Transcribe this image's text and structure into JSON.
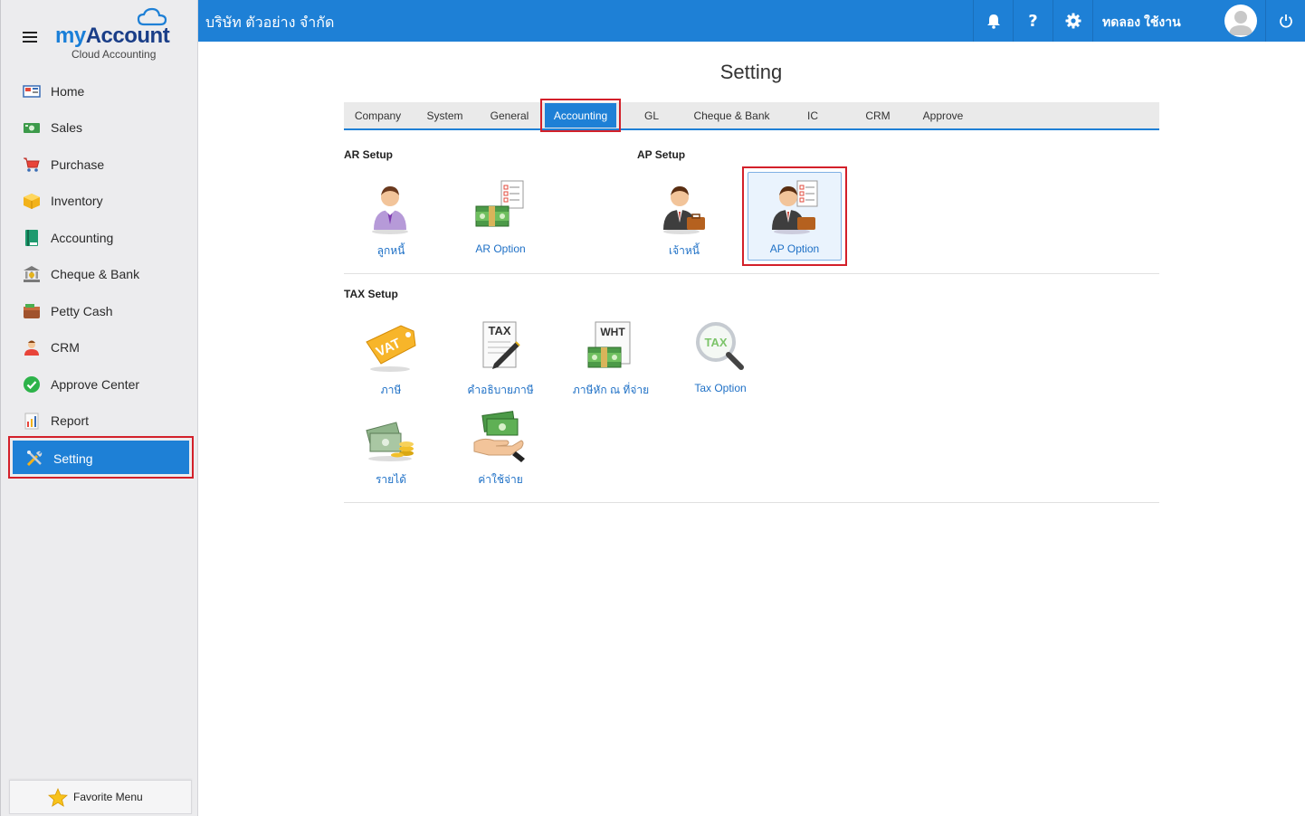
{
  "app": {
    "logo_main": "myAccount",
    "logo_sub": "Cloud Accounting"
  },
  "sidebar": {
    "items": [
      {
        "label": "Home",
        "icon": "home-icon"
      },
      {
        "label": "Sales",
        "icon": "sales-icon"
      },
      {
        "label": "Purchase",
        "icon": "cart-icon"
      },
      {
        "label": "Inventory",
        "icon": "box-icon"
      },
      {
        "label": "Accounting",
        "icon": "book-icon"
      },
      {
        "label": "Cheque & Bank",
        "icon": "bank-icon"
      },
      {
        "label": "Petty Cash",
        "icon": "wallet-icon"
      },
      {
        "label": "CRM",
        "icon": "people-icon"
      },
      {
        "label": "Approve Center",
        "icon": "check-circle-icon"
      },
      {
        "label": "Report",
        "icon": "report-icon"
      },
      {
        "label": "Setting",
        "icon": "tools-icon",
        "active": true
      }
    ],
    "favorite_label": "Favorite Menu"
  },
  "topbar": {
    "company": "บริษัท ตัวอย่าง จำกัด",
    "help_label": "?",
    "user_name": "ทดลอง ใช้งาน"
  },
  "main": {
    "title": "Setting",
    "tabs": [
      "Company",
      "System",
      "General",
      "Accounting",
      "GL",
      "Cheque & Bank",
      "IC",
      "CRM",
      "Approve"
    ],
    "active_tab": "Accounting",
    "sections": {
      "ar": {
        "title": "AR Setup",
        "tiles": [
          "ลูกหนี้",
          "AR Option"
        ]
      },
      "ap": {
        "title": "AP Setup",
        "tiles": [
          "เจ้าหนี้",
          "AP Option"
        ]
      },
      "tax": {
        "title": "TAX Setup",
        "tiles": [
          "ภาษี",
          "คำอธิบายภาษี",
          "ภาษีหัก ณ ที่จ่าย",
          "Tax Option",
          "รายได้",
          "ค่าใช้จ่าย"
        ]
      }
    },
    "icon_text": {
      "vat": "VAT",
      "tax": "TAX",
      "wht": "WHT",
      "tax_mag": "TAX"
    }
  },
  "colors": {
    "brand_blue": "#1e80d6",
    "highlight_red": "#d3202a",
    "link_blue": "#1e70c6"
  }
}
